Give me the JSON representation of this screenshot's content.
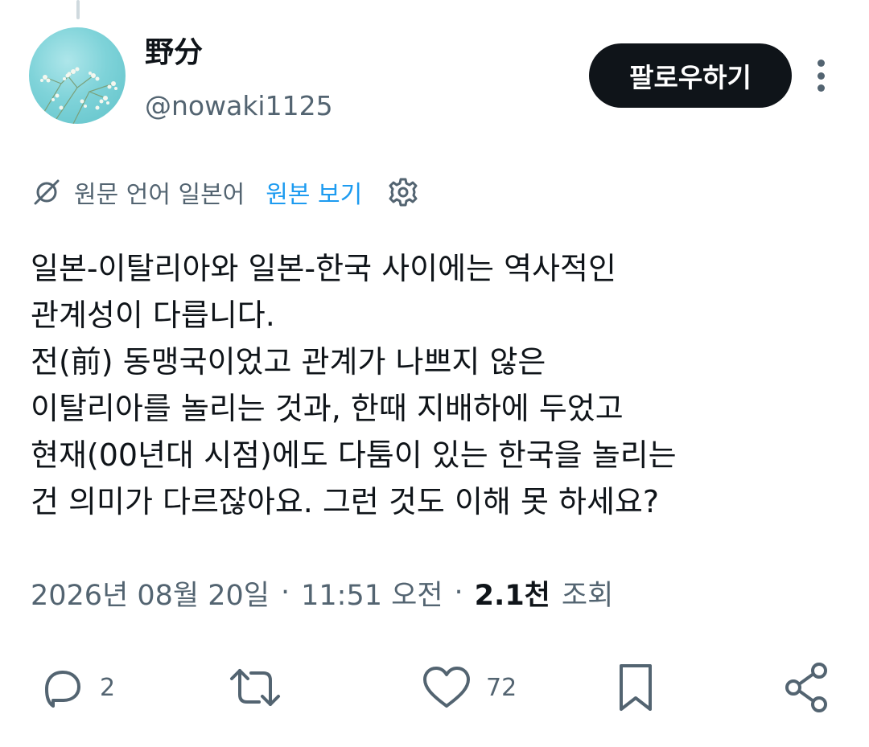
{
  "author": {
    "display_name": "野分",
    "handle": "@nowaki1125"
  },
  "header": {
    "follow_label": "팔로우하기"
  },
  "translation": {
    "label": "원문 언어 일본어",
    "show_original": "원본 보기"
  },
  "tweet": {
    "lines": [
      "일본-이탈리아와 일본-한국 사이에는 역사적인",
      "관계성이 다릅니다.",
      "전(前) 동맹국이었고 관계가 나쁘지 않은",
      "이탈리아를 놀리는 것과, 한때 지배하에 두었고",
      "현재(00년대 시점)에도 다툼이 있는 한국을 놀리는",
      "건 의미가 다르잖아요. 그런 것도 이해 못 하세요?"
    ]
  },
  "meta": {
    "date": "2026년 08월 20일",
    "time": "11:51 오전",
    "views_count": "2.1천",
    "views_label": "조회"
  },
  "actions": {
    "reply_count": "2",
    "like_count": "72"
  },
  "icons": {
    "translate": "translate-icon",
    "settings": "gear-icon",
    "more": "more-icon",
    "reply": "reply-icon",
    "retweet": "retweet-icon",
    "like": "heart-icon",
    "bookmark": "bookmark-icon",
    "share": "share-icon"
  },
  "colors": {
    "accent": "#1d9bf0",
    "text_primary": "#0f1419",
    "text_secondary": "#536471",
    "follow_button_bg": "#0f1419"
  }
}
